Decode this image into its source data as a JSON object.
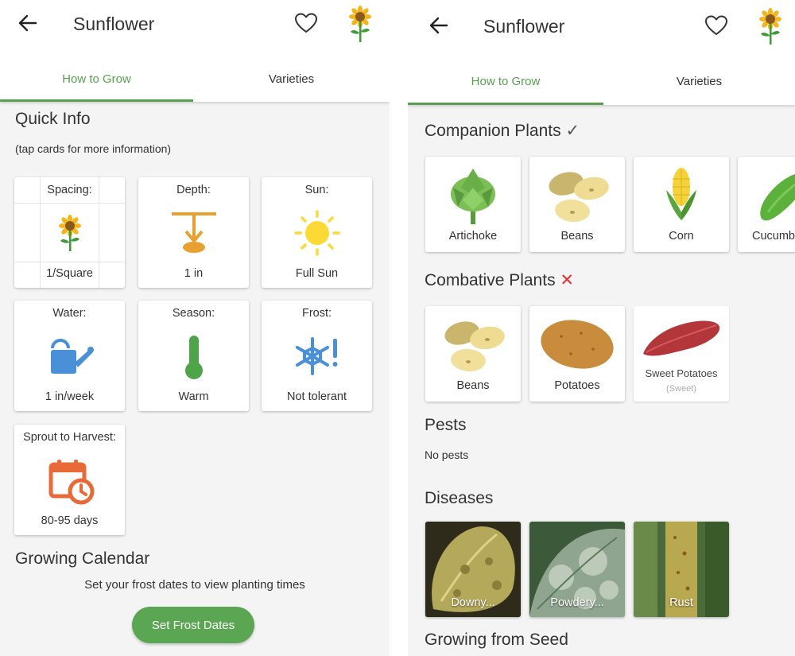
{
  "left": {
    "app_title": "Sunflower",
    "tabs": [
      {
        "label": "How to Grow"
      },
      {
        "label": "Varieties"
      }
    ],
    "quick_info": {
      "heading": "Quick Info",
      "hint": "(tap cards for more information)",
      "cards": [
        {
          "label": "Spacing:",
          "value": "1/Square",
          "icon": "sunflower-icon"
        },
        {
          "label": "Depth:",
          "value": "1 in",
          "icon": "depth-icon"
        },
        {
          "label": "Sun:",
          "value": "Full Sun",
          "icon": "sun-icon"
        },
        {
          "label": "Water:",
          "value": "1 in/week",
          "icon": "watering-can-icon"
        },
        {
          "label": "Season:",
          "value": "Warm",
          "icon": "thermometer-icon"
        },
        {
          "label": "Frost:",
          "value": "Not tolerant",
          "icon": "frost-icon"
        },
        {
          "label": "Sprout to Harvest:",
          "value": "80-95 days",
          "icon": "calendar-clock-icon"
        }
      ]
    },
    "calendar": {
      "heading": "Growing Calendar",
      "message": "Set your frost dates to view planting times",
      "button": "Set Frost Dates"
    }
  },
  "right": {
    "app_title": "Sunflower",
    "tabs": [
      {
        "label": "How to Grow"
      },
      {
        "label": "Varieties"
      }
    ],
    "companion": {
      "heading": "Companion Plants",
      "mark": "✓",
      "items": [
        {
          "label": "Artichoke",
          "icon": "artichoke-icon"
        },
        {
          "label": "Beans",
          "icon": "beans-icon"
        },
        {
          "label": "Corn",
          "icon": "corn-icon"
        },
        {
          "label": "Cucumb",
          "icon": "cucumber-icon"
        }
      ]
    },
    "combative": {
      "heading": "Combative Plants",
      "mark": "✕",
      "items": [
        {
          "label": "Beans",
          "icon": "beans-icon"
        },
        {
          "label": "Potatoes",
          "icon": "potato-icon"
        },
        {
          "label": "Sweet Potatoes",
          "sublabel": "(Sweet)",
          "icon": "sweet-potato-icon"
        }
      ]
    },
    "pests": {
      "heading": "Pests",
      "text": "No pests"
    },
    "diseases": {
      "heading": "Diseases",
      "items": [
        {
          "label": "Downy..."
        },
        {
          "label": "Powdery..."
        },
        {
          "label": "Rust"
        }
      ]
    },
    "seed": {
      "heading": "Growing from Seed"
    }
  },
  "colors": {
    "accent": "#56a04f",
    "button": "#5aa653",
    "frost": "#4a90d9",
    "orange": "#e8a030",
    "red_cross": "#e0302a"
  }
}
